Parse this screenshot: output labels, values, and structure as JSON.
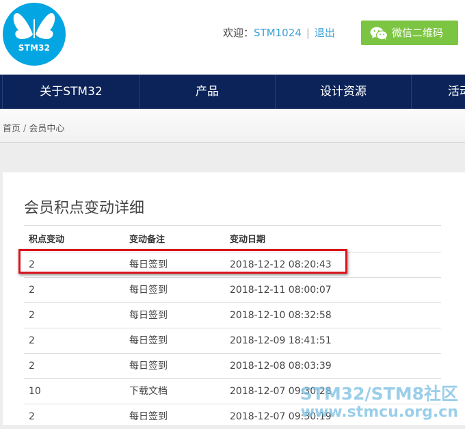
{
  "header": {
    "logo_text": "STM32",
    "welcome": "欢迎：",
    "username": "STM1024",
    "separator": "|",
    "logout": "退出",
    "wechat_button": "微信二维码"
  },
  "nav": {
    "items": [
      "关于STM32",
      "产品",
      "设计资源",
      "活动"
    ]
  },
  "breadcrumb": {
    "home": "首页",
    "separator": "/",
    "current": "会员中心"
  },
  "panel": {
    "title": "会员积点变动详细",
    "columns": [
      "积点变动",
      "变动备注",
      "变动日期"
    ],
    "rows": [
      {
        "points": "2",
        "note": "每日签到",
        "date": "2018-12-12 08:20:43"
      },
      {
        "points": "2",
        "note": "每日签到",
        "date": "2018-12-11 08:00:07"
      },
      {
        "points": "2",
        "note": "每日签到",
        "date": "2018-12-10 08:32:58"
      },
      {
        "points": "2",
        "note": "每日签到",
        "date": "2018-12-09 18:41:51"
      },
      {
        "points": "2",
        "note": "每日签到",
        "date": "2018-12-08 08:03:39"
      },
      {
        "points": "10",
        "note": "下载文档",
        "date": "2018-12-07 09:30:28"
      },
      {
        "points": "2",
        "note": "每日签到",
        "date": "2018-12-07 09:30:19"
      }
    ]
  },
  "watermark": {
    "line1": "STM32/STM8社区",
    "line2": "www.stmcu.org.cn"
  },
  "colors": {
    "brand_blue": "#03a6e2",
    "nav_bg": "#0b2358",
    "wechat_green": "#7cc542",
    "link_blue": "#3a9fd6",
    "highlight_red": "#d9141b"
  },
  "icons": {
    "logo": "butterfly-logo-icon",
    "wechat": "wechat-icon"
  }
}
